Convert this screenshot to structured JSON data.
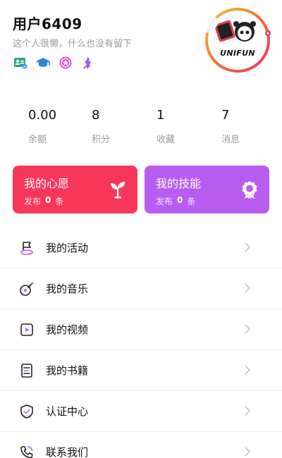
{
  "profile": {
    "username": "用户6409",
    "bio": "这个人很懒，什么也没有留下",
    "badges": [
      "id-card-icon",
      "graduation-cap-icon",
      "star-medal-icon",
      "map-icon"
    ],
    "avatar_text": "UNIFUN"
  },
  "stats": [
    {
      "value": "0.00",
      "label": "余额"
    },
    {
      "value": "8",
      "label": "积分"
    },
    {
      "value": "1",
      "label": "收藏"
    },
    {
      "value": "7",
      "label": "消息"
    }
  ],
  "cards": {
    "wish": {
      "title": "我的心愿",
      "prefix": "发布",
      "count": "0",
      "suffix": "条",
      "color": "#f7375a",
      "icon": "sprout-icon"
    },
    "skill": {
      "title": "我的技能",
      "prefix": "发布",
      "count": "0",
      "suffix": "条",
      "color": "#b95cf2",
      "icon": "award-icon"
    }
  },
  "menu": [
    {
      "label": "我的活动",
      "icon": "flag-icon"
    },
    {
      "label": "我的音乐",
      "icon": "music-icon"
    },
    {
      "label": "我的视频",
      "icon": "video-icon"
    },
    {
      "label": "我的书籍",
      "icon": "book-icon"
    },
    {
      "label": "认证中心",
      "icon": "shield-check-icon"
    },
    {
      "label": "联系我们",
      "icon": "phone-icon"
    }
  ],
  "colors": {
    "accent_pink": "#f7375a",
    "accent_purple": "#b95cf2",
    "icon_purple": "#c06bf0",
    "muted": "#9a9a9a"
  }
}
